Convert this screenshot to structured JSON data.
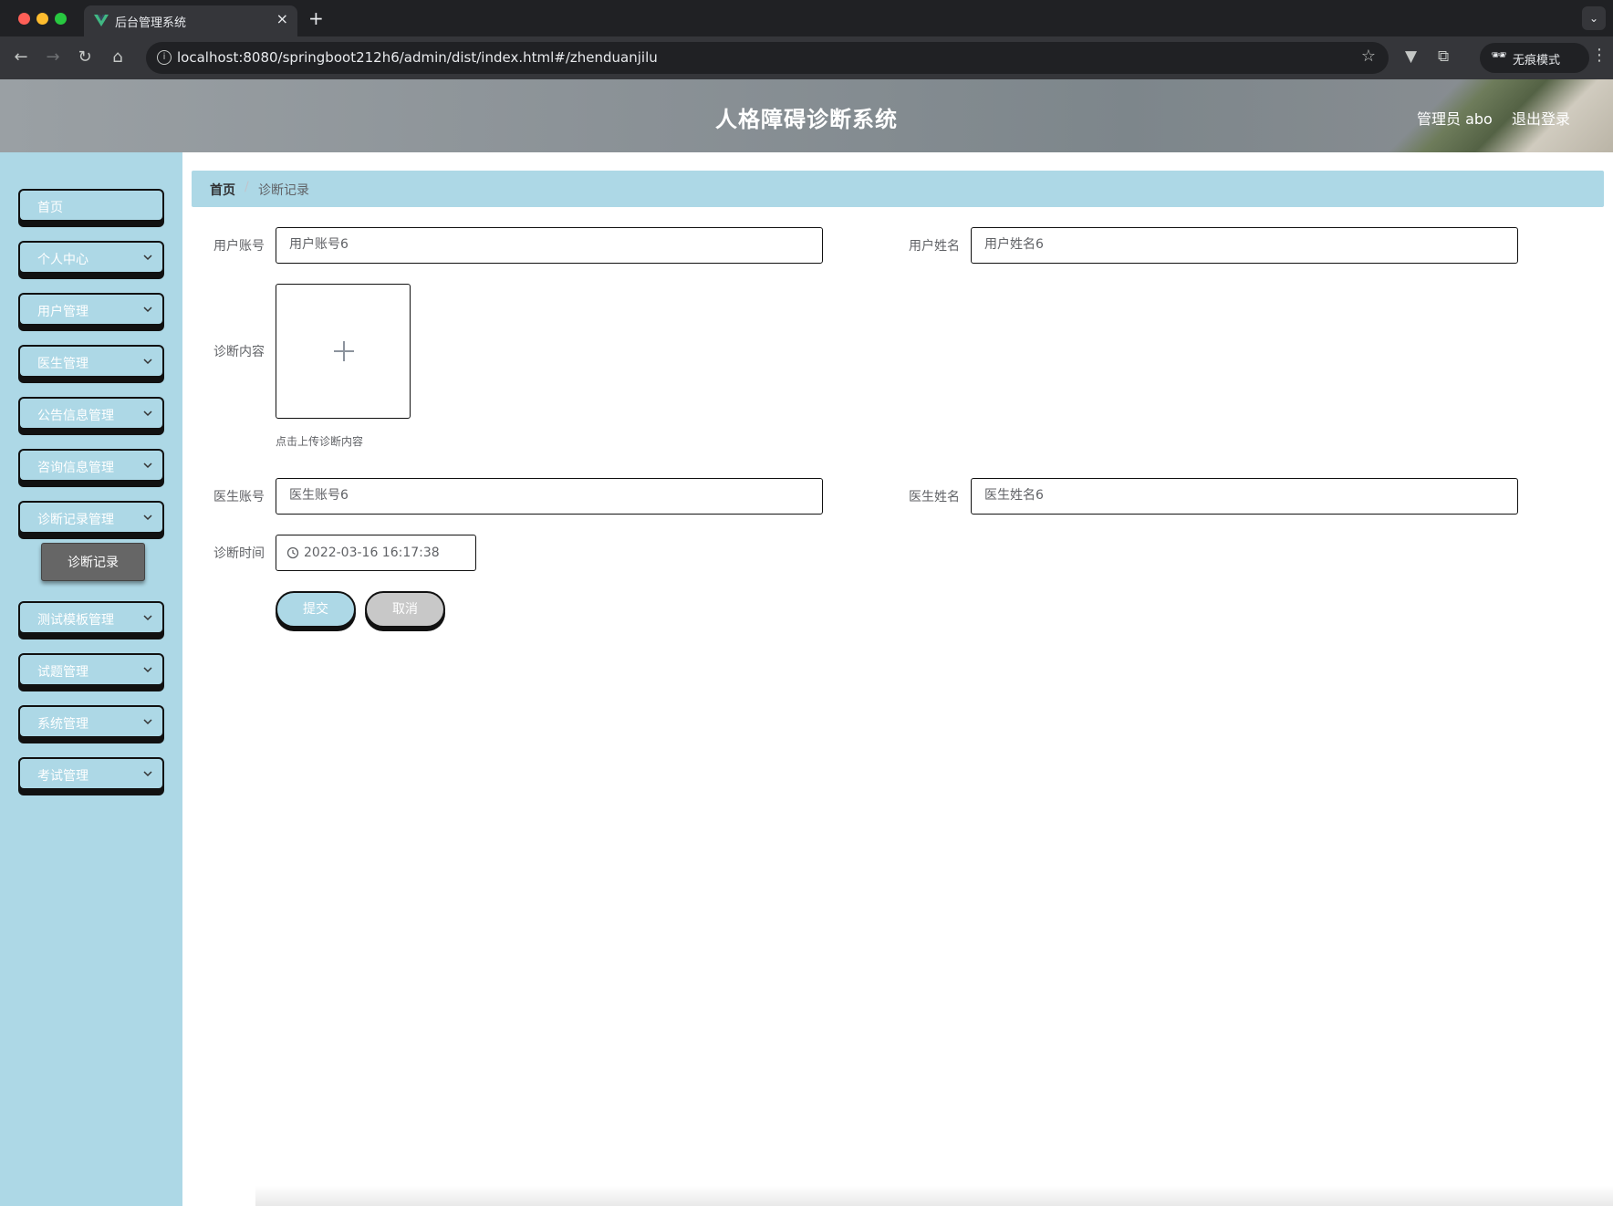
{
  "browser": {
    "tab_title": "后台管理系统",
    "tab_close": "×",
    "new_tab": "+",
    "url": "localhost:8080/springboot212h6/admin/dist/index.html#/zhenduanjilu",
    "incognito_label": "无痕模式"
  },
  "header": {
    "title": "人格障碍诊断系统",
    "user": "管理员 abo",
    "logout": "退出登录"
  },
  "sidebar": {
    "items": [
      {
        "label": "首页"
      },
      {
        "label": "个人中心"
      },
      {
        "label": "用户管理"
      },
      {
        "label": "医生管理"
      },
      {
        "label": "公告信息管理"
      },
      {
        "label": "咨询信息管理"
      },
      {
        "label": "诊断记录管理"
      },
      {
        "label": "测试模板管理"
      },
      {
        "label": "试题管理"
      },
      {
        "label": "系统管理"
      },
      {
        "label": "考试管理"
      }
    ],
    "submenu_active": "诊断记录"
  },
  "breadcrumb": {
    "home": "首页",
    "separator": "/",
    "current": "诊断记录"
  },
  "form": {
    "user_account": {
      "label": "用户账号",
      "placeholder": "用户账号6"
    },
    "user_name": {
      "label": "用户姓名",
      "placeholder": "用户姓名6"
    },
    "diagnosis_content": {
      "label": "诊断内容",
      "hint": "点击上传诊断内容"
    },
    "doctor_account": {
      "label": "医生账号",
      "placeholder": "医生账号6"
    },
    "doctor_name": {
      "label": "医生姓名",
      "placeholder": "医生姓名6"
    },
    "diagnosis_time": {
      "label": "诊断时间",
      "value": "2022-03-16 16:17:38"
    },
    "submit": "提交",
    "cancel": "取消"
  },
  "colors": {
    "accent": "#add8e6",
    "active_submenu": "#666666",
    "cancel_button": "#c8c8c8"
  }
}
